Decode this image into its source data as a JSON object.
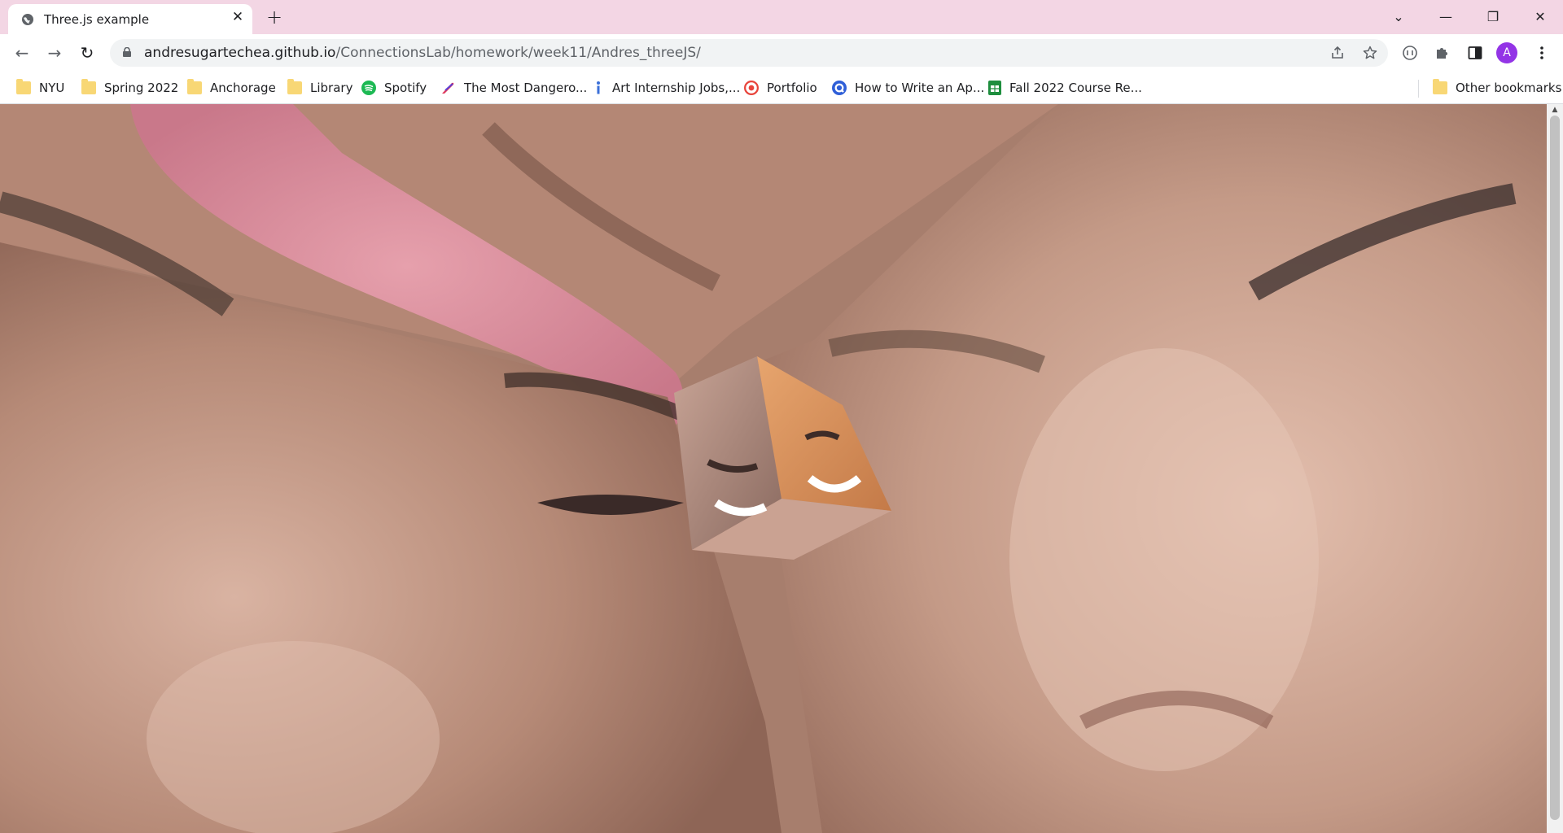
{
  "tab": {
    "title": "Three.js example",
    "close_glyph": "✕"
  },
  "new_tab_glyph": "+",
  "window_controls": {
    "tab_search": "⌄",
    "minimize": "—",
    "restore": "❐",
    "close": "✕"
  },
  "toolbar": {
    "back": "←",
    "forward": "→",
    "reload": "↻",
    "url_host": "andresugartechea.github.io",
    "url_path": "/ConnectionsLab/homework/week11/Andres_threeJS/",
    "share_icon": "share-icon",
    "star_icon": "bookmark-star-icon",
    "avatar_letter": "A",
    "avatar_color": "#9334e6"
  },
  "bookmarks": [
    {
      "label": "NYU",
      "icon": "folder-icon"
    },
    {
      "label": "Spring 2022",
      "icon": "folder-icon"
    },
    {
      "label": "Anchorage",
      "icon": "folder-icon"
    },
    {
      "label": "Library",
      "icon": "folder-icon"
    },
    {
      "label": "Spotify",
      "icon": "spotify-icon"
    },
    {
      "label": "The Most Dangero...",
      "icon": "quill-icon"
    },
    {
      "label": "Art Internship Jobs,...",
      "icon": "info-icon"
    },
    {
      "label": "Portfolio",
      "icon": "portfolio-icon"
    },
    {
      "label": "How to Write an Ap...",
      "icon": "search-q-icon"
    },
    {
      "label": "Fall 2022 Course Re...",
      "icon": "sheets-icon"
    }
  ],
  "other_bookmarks": "Other bookmarks",
  "scene": {
    "description_colors": {
      "skin": "#c79a86",
      "tongue": "#d98a98",
      "brow": "#5a4034"
    }
  }
}
